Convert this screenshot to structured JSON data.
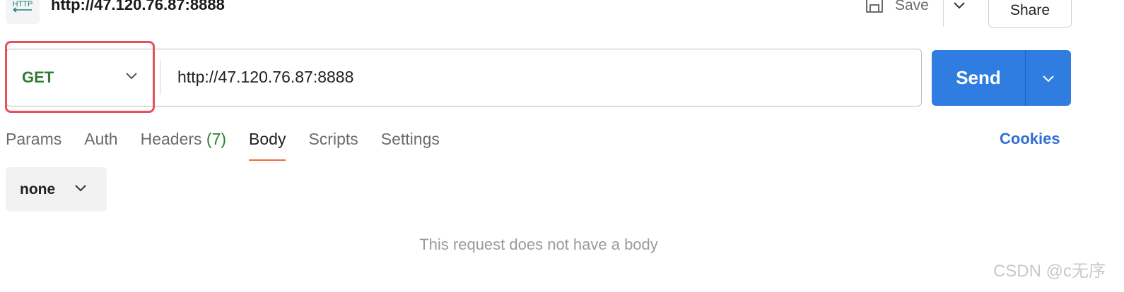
{
  "header": {
    "icon_text": "HTTP",
    "title": "http://47.120.76.87:8888",
    "save_label": "Save",
    "share_label": "Share"
  },
  "request": {
    "method": "GET",
    "url": "http://47.120.76.87:8888",
    "send_label": "Send"
  },
  "tabs": [
    {
      "label": "Params"
    },
    {
      "label": "Auth"
    },
    {
      "label": "Headers",
      "count": "(7)"
    },
    {
      "label": "Body",
      "active": true
    },
    {
      "label": "Scripts"
    },
    {
      "label": "Settings"
    }
  ],
  "cookies_label": "Cookies",
  "body": {
    "type": "none",
    "empty_message": "This request does not have a body"
  },
  "watermark": "CSDN @c无序",
  "colors": {
    "method_green": "#2e7d32",
    "send_blue": "#2f7de1",
    "active_tab_underline": "#f26b3a",
    "highlight_red": "#e8505b",
    "cookies_blue": "#2f6fd6"
  }
}
